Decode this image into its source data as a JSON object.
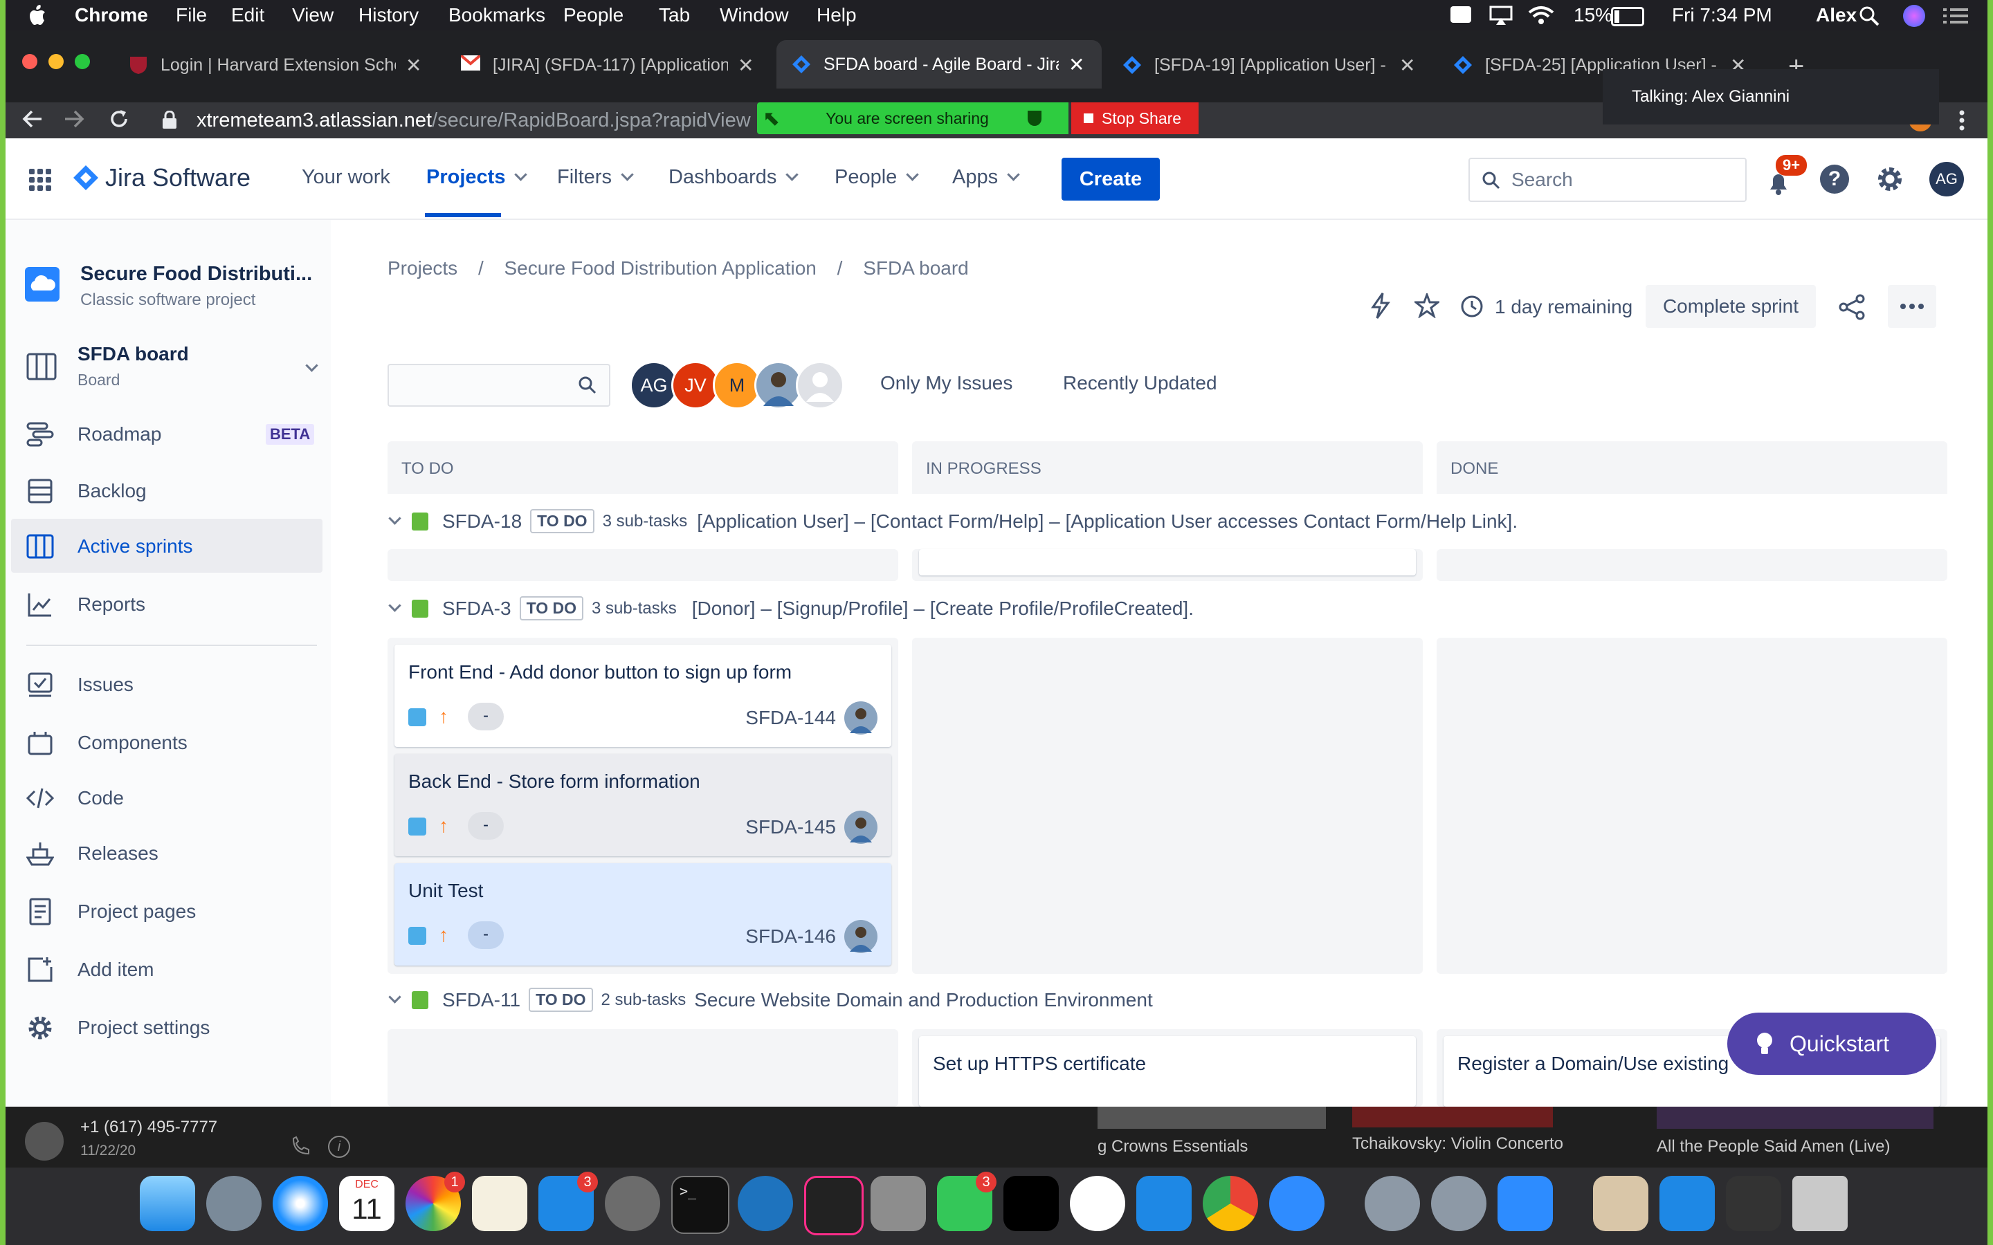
{
  "menubar": {
    "apple": "",
    "app": "Chrome",
    "items": [
      "File",
      "Edit",
      "View",
      "History",
      "Bookmarks",
      "People",
      "Tab",
      "Window",
      "Help"
    ],
    "battery": "15%",
    "clock": "Fri 7:34 PM",
    "user": "Alex"
  },
  "tabs": [
    {
      "title": "Login | Harvard Extension Scho"
    },
    {
      "title": "[JIRA] (SFDA-117) [Application"
    },
    {
      "title": "SFDA board - Agile Board - Jira"
    },
    {
      "title": "[SFDA-19] [Application User] -"
    },
    {
      "title": "[SFDA-25] [Application User] -"
    }
  ],
  "address": {
    "host": "xtremeteam3.atlassian.net",
    "path": "/secure/RapidBoard.jspa?rapidView"
  },
  "screenshare": {
    "status": "You are screen sharing",
    "stop": "Stop Share",
    "talking": "Talking: Alex Giannini"
  },
  "topnav": {
    "product": "Jira Software",
    "items": [
      "Your work",
      "Projects",
      "Filters",
      "Dashboards",
      "People",
      "Apps"
    ],
    "create": "Create",
    "search_placeholder": "Search",
    "notif": "9+",
    "avatar": "AG"
  },
  "sidebar": {
    "project_name": "Secure Food Distributi...",
    "project_type": "Classic software project",
    "board_name": "SFDA board",
    "board_type": "Board",
    "items": [
      "Roadmap",
      "Backlog",
      "Active sprints",
      "Reports",
      "Issues",
      "Components",
      "Code",
      "Releases",
      "Project pages",
      "Add item",
      "Project settings"
    ],
    "beta": "BETA"
  },
  "breadcrumb": [
    "Projects",
    "Secure Food Distribution Application",
    "SFDA board"
  ],
  "sprint": {
    "remaining": "1 day remaining",
    "complete": "Complete sprint"
  },
  "filters": {
    "avatars": [
      "AG",
      "JV",
      "M"
    ],
    "only_mine": "Only My Issues",
    "recent": "Recently Updated"
  },
  "columns": [
    "TO DO",
    "IN PROGRESS",
    "DONE"
  ],
  "swimlanes": [
    {
      "key": "SFDA-18",
      "status": "TO DO",
      "subtasks": "3 sub-tasks",
      "title": "[Application User] – [Contact Form/Help] – [Application User accesses Contact Form/Help Link]."
    },
    {
      "key": "SFDA-3",
      "status": "TO DO",
      "subtasks": "3 sub-tasks",
      "title": "[Donor] – [Signup/Profile] – [Create Profile/ProfileCreated]."
    },
    {
      "key": "SFDA-11",
      "status": "TO DO",
      "subtasks": "2 sub-tasks",
      "title": "Secure Website Domain and Production Environment"
    }
  ],
  "cards": [
    {
      "title": "Front End - Add donor button to sign up form",
      "key": "SFDA-144",
      "est": "-"
    },
    {
      "title": "Back End - Store form information",
      "key": "SFDA-145",
      "est": "-"
    },
    {
      "title": "Unit Test",
      "key": "SFDA-146",
      "est": "-"
    },
    {
      "title": "Set up HTTPS certificate"
    },
    {
      "title": "Register a Domain/Use existing"
    }
  ],
  "quickstart": "Quickstart",
  "call": {
    "number": "+1 (617) 495-7777",
    "date": "11/22/20"
  },
  "music": [
    "g Crowns Essentials",
    "Tchaikovsky: Violin Concerto",
    "All the People Said Amen (Live)"
  ],
  "dock_badges": {
    "photos": "1",
    "appstore": "3",
    "facetime": "3"
  },
  "calendar": {
    "month": "DEC",
    "day": "11"
  }
}
